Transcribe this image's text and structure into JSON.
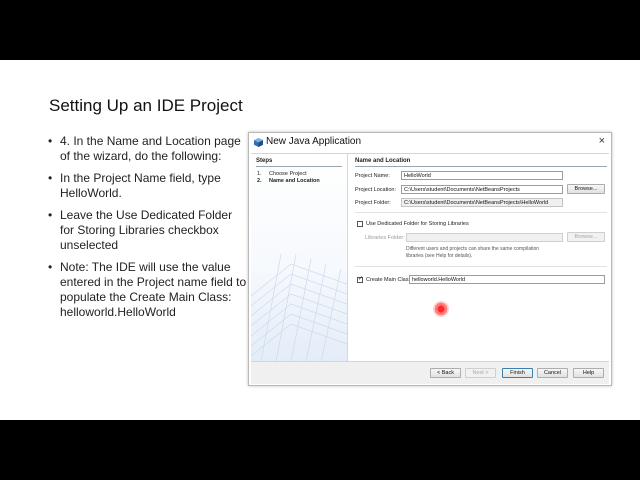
{
  "slide": {
    "title": "Setting Up an IDE Project",
    "bullets": [
      "4. In the Name and Location page of the wizard, do the following:",
      "In the Project Name field, type HelloWorld.",
      "Leave the Use Dedicated Folder for Storing Libraries checkbox unselected",
      "Note: The IDE will use the value entered in the Project name field to populate the Create Main Class: helloworld.HelloWorld"
    ]
  },
  "dialog": {
    "title": "New Java Application",
    "close_glyph": "×",
    "steps": {
      "heading": "Steps",
      "items": [
        {
          "num": "1.",
          "label": "Choose Project"
        },
        {
          "num": "2.",
          "label": "Name and Location"
        }
      ]
    },
    "section_heading": "Name and Location",
    "project_name": {
      "label": "Project Name:",
      "value": "HelloWorld"
    },
    "project_location": {
      "label": "Project Location:",
      "value": "C:\\Users\\student\\Documents\\NetBeansProjects",
      "browse": "Browse..."
    },
    "project_folder": {
      "label": "Project Folder:",
      "value": "C:\\Users\\student\\Documents\\NetBeansProjects\\HelloWorld"
    },
    "dedicated_folder": {
      "label": "Use Dedicated Folder for Storing Libraries",
      "checked": false
    },
    "libraries_folder": {
      "label": "Libraries Folder:",
      "value": "",
      "browse": "Browse..."
    },
    "libraries_hint": [
      "Different users and projects can share the same compilation",
      "libraries (see Help for details)."
    ],
    "create_main_class": {
      "label": "Create Main Class",
      "checked": true,
      "value": "helloworld.HelloWorld"
    },
    "buttons": {
      "back": "< Back",
      "next": "Next >",
      "finish": "Finish",
      "cancel": "Cancel",
      "help": "Help"
    }
  }
}
